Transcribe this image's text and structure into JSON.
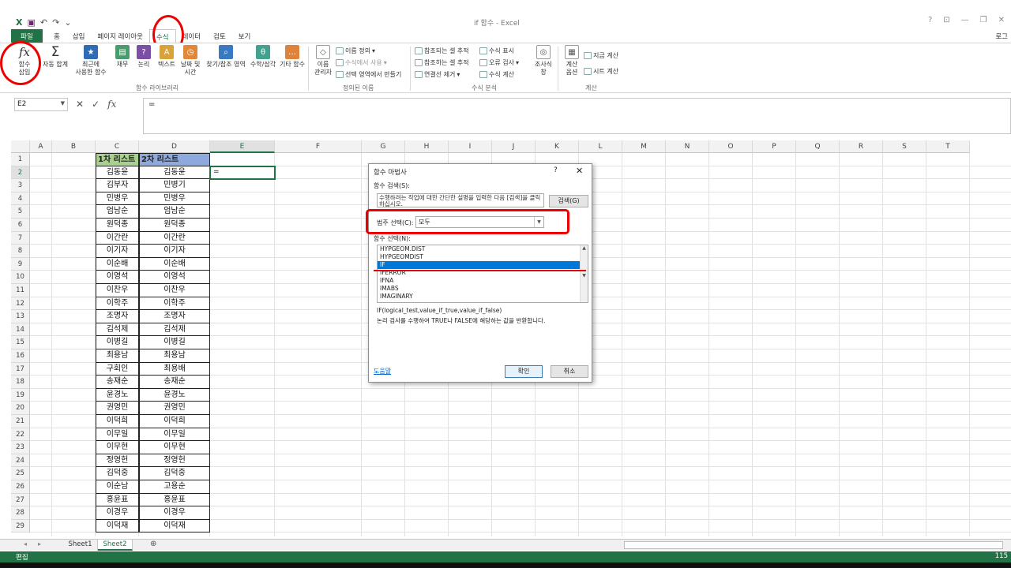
{
  "window": {
    "title": "if 함수 - Excel",
    "help": "?",
    "ribbon_opts": "⊡",
    "minimize": "—",
    "restore": "❐",
    "close": "✕",
    "user": "로그"
  },
  "qat": {
    "undo": "↶",
    "redo": "↷",
    "more": "⌄"
  },
  "tabs": [
    "파일",
    "홈",
    "삽입",
    "페이지 레이아웃",
    "수식",
    "데이터",
    "검토",
    "보기"
  ],
  "ribbon": {
    "insert_function": "함수\n삽입",
    "autosum": "자동 합계",
    "recent": "최근에\n사용한 함수",
    "financial": "재무",
    "logical": "논리",
    "text": "텍스트",
    "datetime": "날짜 및\n시간",
    "lookup": "찾기/참조 영역",
    "math": "수학/삼각",
    "more_fn": "기타 함수",
    "group_library": "함수 라이브러리",
    "name_manager": "이름\n관리자",
    "define_name": "이름 정의",
    "use_in_formula": "수식에서 사용",
    "create_from_sel": "선택 영역에서 만들기",
    "group_names": "정의된 이름",
    "trace_precedents": "참조되는 셀 추적",
    "trace_dependents": "참조하는 셀 추적",
    "remove_arrows": "연결선 제거",
    "show_formulas": "수식 표시",
    "error_check": "오류 검사",
    "eval_formula": "수식 계산",
    "watch": "조사식\n창",
    "group_audit": "수식 분석",
    "calc_options": "계산\n옵션",
    "calc_now": "지금 계산",
    "calc_sheet": "시트 계산",
    "group_calc": "계산"
  },
  "formula_bar": {
    "name": "E2",
    "content": "=",
    "fx": "fx",
    "cancel": "✕",
    "enter": "✓"
  },
  "columns": [
    "A",
    "B",
    "C",
    "D",
    "E",
    "F",
    "G",
    "H",
    "I",
    "J",
    "K",
    "L",
    "M",
    "N",
    "O",
    "P",
    "Q",
    "R",
    "S",
    "T"
  ],
  "rows": [
    "1",
    "2",
    "3",
    "4",
    "5",
    "6",
    "7",
    "8",
    "9",
    "10",
    "11",
    "12",
    "13",
    "14",
    "15",
    "16",
    "17",
    "18",
    "19",
    "20",
    "21",
    "22",
    "23",
    "24",
    "25",
    "26",
    "27",
    "28",
    "29"
  ],
  "sheet": {
    "header_c": "1차 리스트",
    "header_d": "2차 리스트",
    "e2": "=",
    "list1": [
      "김동윤",
      "김부자",
      "민병우",
      "엄남순",
      "원덕종",
      "이간란",
      "이기자",
      "이순배",
      "이영석",
      "이찬우",
      "이학주",
      "조명자",
      "김석제",
      "이병길",
      "최용남",
      "구회인",
      "송재순",
      "윤경노",
      "권영민",
      "이덕희",
      "이무일",
      "이무현",
      "정영헌",
      "김덕중",
      "이순남",
      "홍윤표",
      "이경우",
      "이덕재"
    ],
    "list2": [
      "김동윤",
      "민병기",
      "민병우",
      "엄남순",
      "원덕종",
      "이간란",
      "이기자",
      "이순배",
      "이영석",
      "이찬우",
      "이학주",
      "조명자",
      "김석제",
      "이병길",
      "최용남",
      "최용배",
      "송재순",
      "윤경노",
      "권영민",
      "이덕희",
      "이무일",
      "이무현",
      "정영헌",
      "김덕중",
      "고용순",
      "홍윤표",
      "이경우",
      "이덕재"
    ]
  },
  "sheet_tabs": [
    "Sheet1",
    "Sheet2"
  ],
  "sheet_nav": {
    "prev": "◂",
    "next": "▸",
    "add": "⊕"
  },
  "status": {
    "mode": "편집",
    "zoom": "115"
  },
  "dialog": {
    "title": "함수 마법사",
    "help_icon": "?",
    "close_icon": "✕",
    "search_label": "함수 검색(S):",
    "search_value": "수행하려는 작업에 대한 간단한 설명을 입력한 다음 [검색]을 클릭하십시오.",
    "search_button": "검색(G)",
    "category_label": "범주 선택(C):",
    "category_value": "모두",
    "function_label": "함수 선택(N):",
    "functions": [
      "HYPGEOM.DIST",
      "HYPGEOMDIST",
      "IF",
      "IFERROR",
      "IFNA",
      "IMABS",
      "IMAGINARY"
    ],
    "selected": "IF",
    "signature": "IF(logical_test,value_if_true,value_if_false)",
    "description": "논리 검사를 수행하여 TRUE나 FALSE에 해당하는 값을 반환합니다.",
    "help_link": "도움말",
    "ok": "확인",
    "cancel": "취소"
  },
  "colors": {
    "accent": "#217346",
    "header_c_bg": "#a9d08e",
    "header_d_bg": "#8ea9db",
    "highlight": "#ee0000",
    "selection": "#0078d7"
  }
}
